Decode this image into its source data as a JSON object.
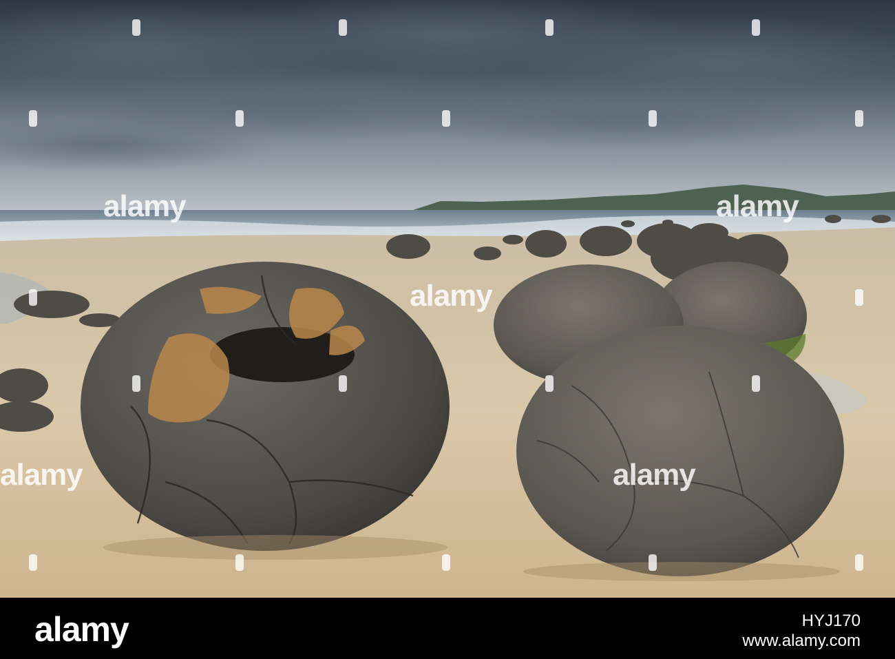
{
  "photo": {
    "subject": "",
    "watermark_text": "alamy"
  },
  "footer": {
    "logo": "alamy",
    "image_id": "HYJ170",
    "site": "www.alamy.com"
  },
  "colors": {
    "footer_bg": "#000000",
    "sky_dark": "#3a4450",
    "sand": "#d8c7a8",
    "boulder": "#55524c"
  }
}
